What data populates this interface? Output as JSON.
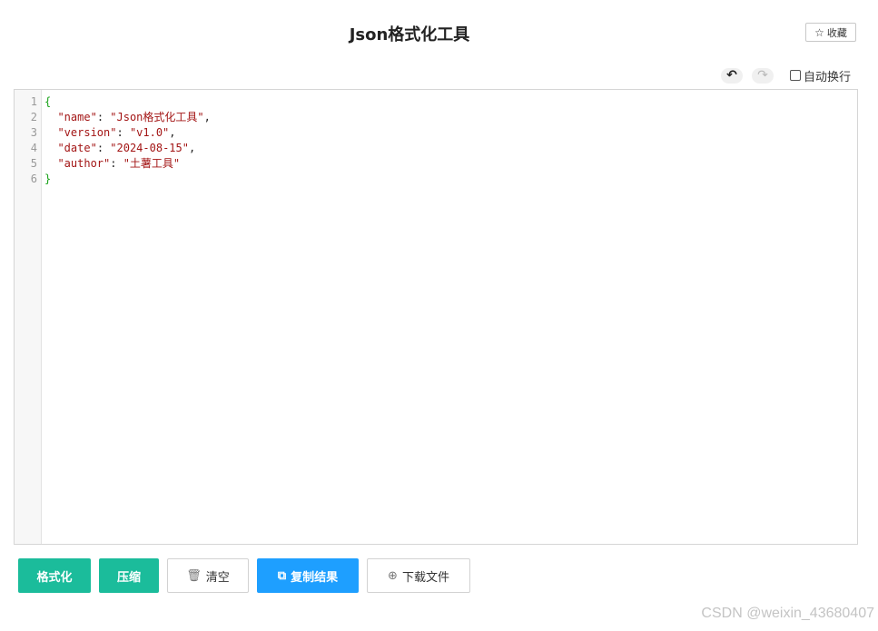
{
  "header": {
    "title": "Json格式化工具",
    "favorite_label": "收藏",
    "favorite_icon": "star-outline-icon"
  },
  "toolbar": {
    "undo_icon": "undo-icon",
    "redo_icon": "redo-icon",
    "wrap_label": "自动换行",
    "wrap_checked": false
  },
  "editor": {
    "line_numbers": [
      "1",
      "2",
      "3",
      "4",
      "5",
      "6"
    ],
    "lines": [
      {
        "indent": "",
        "key": "",
        "value": "",
        "trail": "",
        "brace": "{"
      },
      {
        "indent": "  ",
        "key": "\"name\"",
        "value": "\"Json格式化工具\"",
        "trail": ",",
        "brace": ""
      },
      {
        "indent": "  ",
        "key": "\"version\"",
        "value": "\"v1.0\"",
        "trail": ",",
        "brace": ""
      },
      {
        "indent": "  ",
        "key": "\"date\"",
        "value": "\"2024-08-15\"",
        "trail": ",",
        "brace": ""
      },
      {
        "indent": "  ",
        "key": "\"author\"",
        "value": "\"土薯工具\"",
        "trail": "",
        "brace": ""
      },
      {
        "indent": "",
        "key": "",
        "value": "",
        "trail": "",
        "brace": "}"
      }
    ]
  },
  "actions": {
    "format_label": "格式化",
    "compress_label": "压缩",
    "clear_label": "清空",
    "clear_icon": "trash-icon",
    "copy_label": "复制结果",
    "copy_icon": "copy-icon",
    "download_label": "下载文件",
    "download_icon": "download-icon"
  },
  "watermark": "CSDN @weixin_43680407",
  "colors": {
    "teal": "#1bbc9b",
    "blue": "#1e9fff",
    "brace": "#1aa31a",
    "string": "#a31515"
  }
}
